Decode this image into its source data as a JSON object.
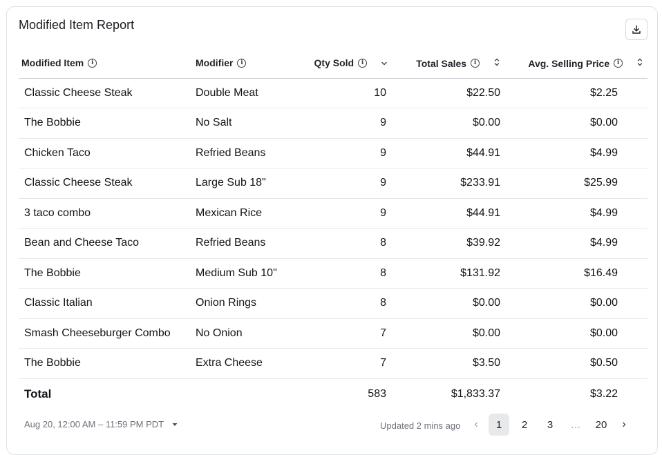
{
  "report": {
    "title": "Modified Item Report",
    "download_icon": "download-icon"
  },
  "columns": {
    "item": "Modified Item",
    "modifier": "Modifier",
    "qty": "Qty Sold",
    "sales": "Total Sales",
    "avg": "Avg. Selling Price"
  },
  "rows": [
    {
      "item": "Classic Cheese Steak",
      "modifier": "Double Meat",
      "qty": "10",
      "sales": "$22.50",
      "avg": "$2.25"
    },
    {
      "item": "The Bobbie",
      "modifier": "No Salt",
      "qty": "9",
      "sales": "$0.00",
      "avg": "$0.00"
    },
    {
      "item": "Chicken Taco",
      "modifier": "Refried Beans",
      "qty": "9",
      "sales": "$44.91",
      "avg": "$4.99"
    },
    {
      "item": "Classic Cheese Steak",
      "modifier": "Large Sub 18\"",
      "qty": "9",
      "sales": "$233.91",
      "avg": "$25.99"
    },
    {
      "item": "3 taco combo",
      "modifier": "Mexican Rice",
      "qty": "9",
      "sales": "$44.91",
      "avg": "$4.99"
    },
    {
      "item": "Bean and Cheese Taco",
      "modifier": "Refried Beans",
      "qty": "8",
      "sales": "$39.92",
      "avg": "$4.99"
    },
    {
      "item": "The Bobbie",
      "modifier": "Medium Sub 10\"",
      "qty": "8",
      "sales": "$131.92",
      "avg": "$16.49"
    },
    {
      "item": "Classic Italian",
      "modifier": "Onion Rings",
      "qty": "8",
      "sales": "$0.00",
      "avg": "$0.00"
    },
    {
      "item": "Smash Cheeseburger Combo",
      "modifier": "No Onion",
      "qty": "7",
      "sales": "$0.00",
      "avg": "$0.00"
    },
    {
      "item": "The Bobbie",
      "modifier": "Extra Cheese",
      "qty": "7",
      "sales": "$3.50",
      "avg": "$0.50"
    }
  ],
  "total": {
    "label": "Total",
    "qty": "583",
    "sales": "$1,833.37",
    "avg": "$3.22"
  },
  "footer": {
    "date_range": "Aug 20, 12:00 AM – 11:59 PM PDT",
    "updated": "Updated 2 mins ago"
  },
  "pagination": {
    "prev": "‹",
    "pages": [
      "1",
      "2",
      "3"
    ],
    "ellipsis": "…",
    "last": "20",
    "next": "›",
    "current": "1"
  }
}
